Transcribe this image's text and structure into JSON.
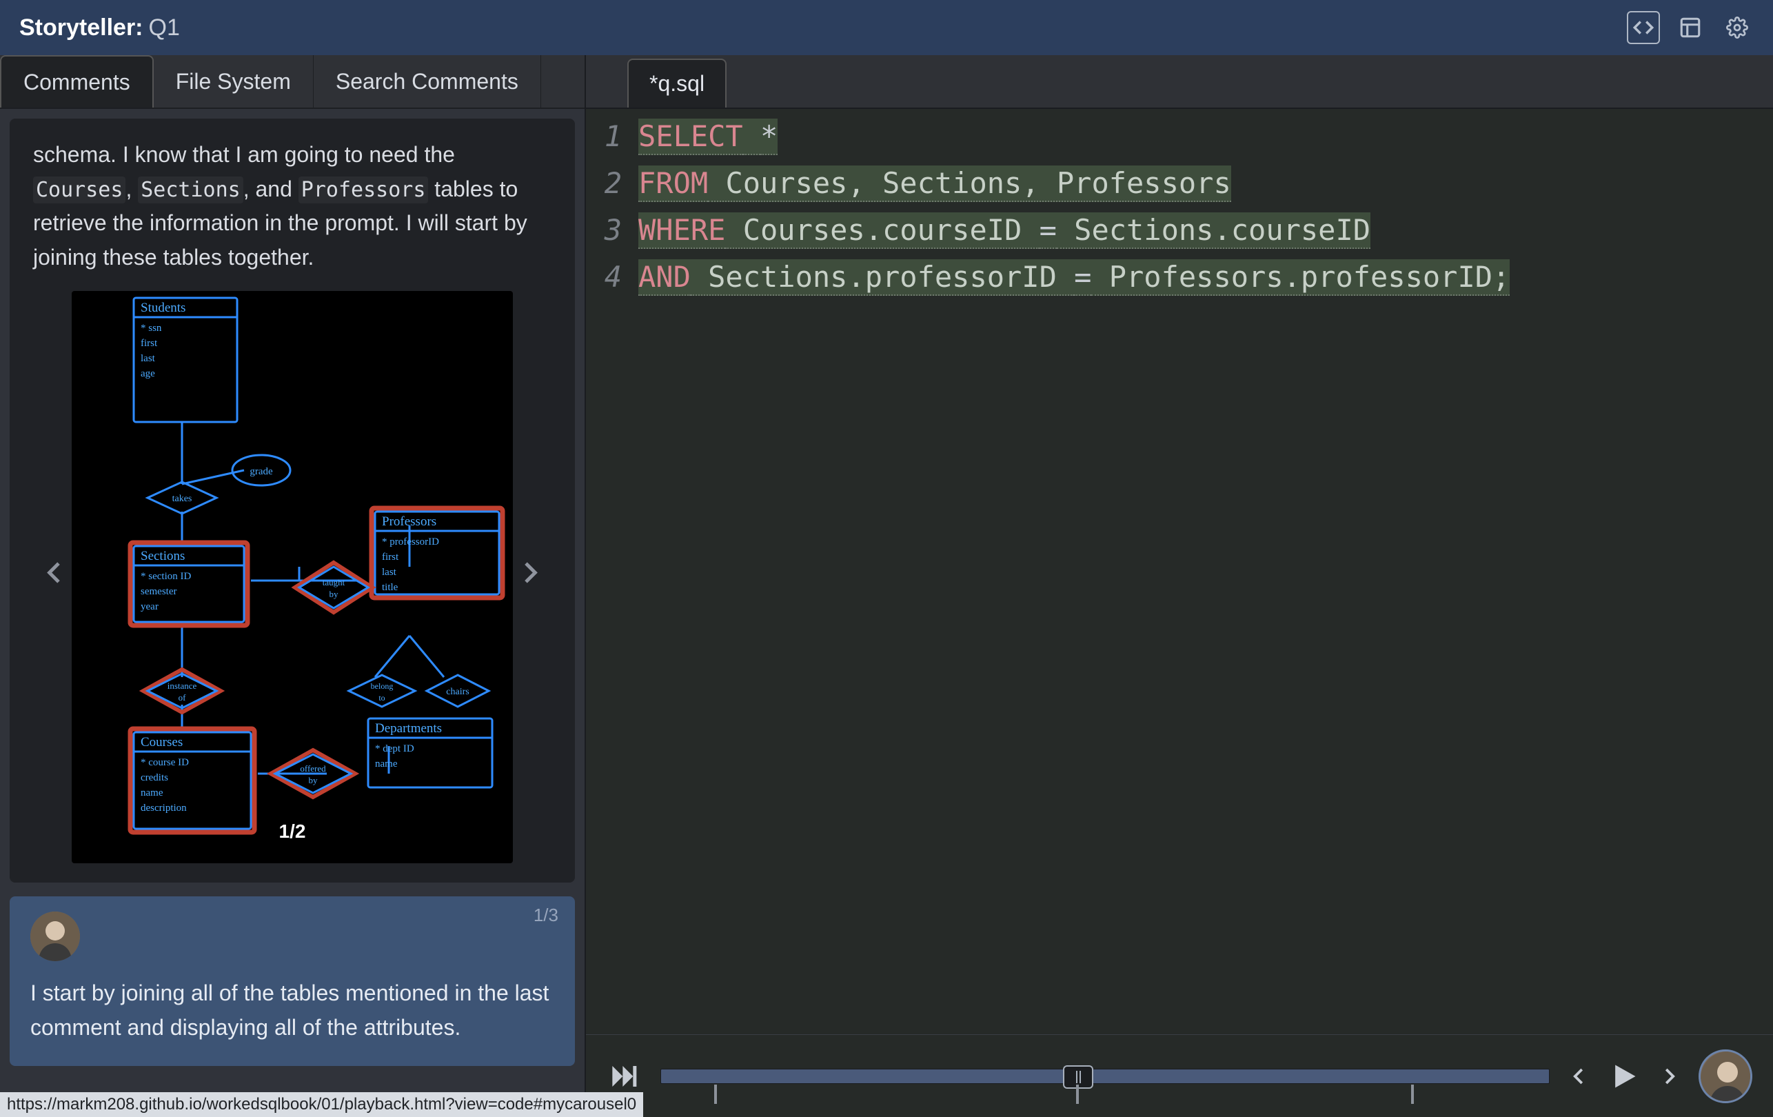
{
  "header": {
    "title": "Storyteller:",
    "subtitle": "Q1"
  },
  "left_tabs": [
    "Comments",
    "File System",
    "Search Comments"
  ],
  "active_left_tab": 0,
  "comment1": {
    "text_before": "schema. I know that I am going to need the ",
    "code_tokens": [
      "Courses",
      "Sections",
      "Professors"
    ],
    "joiners": [
      ", ",
      ", and "
    ],
    "text_after": " tables to retrieve the information in the prompt. I will start by joining these tables together.",
    "image_pager": "1/2"
  },
  "comment2": {
    "counter": "1/3",
    "text": "I start by joining all of the tables mentioned in the last comment and displaying all of the attributes."
  },
  "file_tab": "*q.sql",
  "code_lines": [
    [
      {
        "t": "SELECT",
        "c": "kw",
        "h": true
      },
      {
        "t": " ",
        "c": "id",
        "h": true
      },
      {
        "t": "*",
        "c": "op",
        "h": true
      }
    ],
    [
      {
        "t": "FROM",
        "c": "kw",
        "h": true
      },
      {
        "t": " Courses, Sections, Professors",
        "c": "id",
        "h": true
      }
    ],
    [
      {
        "t": "WHERE",
        "c": "kw",
        "h": true
      },
      {
        "t": " Courses.courseID ",
        "c": "id",
        "h": true
      },
      {
        "t": "=",
        "c": "op",
        "h": true
      },
      {
        "t": " Sections.courseID",
        "c": "id",
        "h": true
      }
    ],
    [
      {
        "t": "AND",
        "c": "kw",
        "h": true
      },
      {
        "t": " Sections.professorID ",
        "c": "id",
        "h": true
      },
      {
        "t": "=",
        "c": "op",
        "h": true
      },
      {
        "t": " Professors.professorID;",
        "c": "id",
        "h": true
      }
    ]
  ],
  "playbar": {
    "progress_pct": 47,
    "ticks_pct": [
      3,
      45,
      84
    ]
  },
  "status_url": "https://markm208.github.io/workedsqlbook/01/playback.html?view=code#mycarousel0",
  "diagram": {
    "entities": {
      "students": {
        "label": "Students",
        "attrs": [
          "* ssn",
          "first",
          "last",
          "age"
        ]
      },
      "sections": {
        "label": "Sections",
        "attrs": [
          "* section ID",
          "semester",
          "year"
        ]
      },
      "professors": {
        "label": "Professors",
        "attrs": [
          "* professorID",
          "first",
          "last",
          "title"
        ]
      },
      "courses": {
        "label": "Courses",
        "attrs": [
          "* course ID",
          "credits",
          "name",
          "description"
        ]
      },
      "departments": {
        "label": "Departments",
        "attrs": [
          "* dept ID",
          "name"
        ]
      }
    },
    "rels": {
      "takes": "takes",
      "grade": "grade",
      "taught_by": "taught by",
      "instance_of": "instance of",
      "offered_by": "offered by",
      "belong_to": "belong to",
      "chairs": "chairs"
    }
  }
}
